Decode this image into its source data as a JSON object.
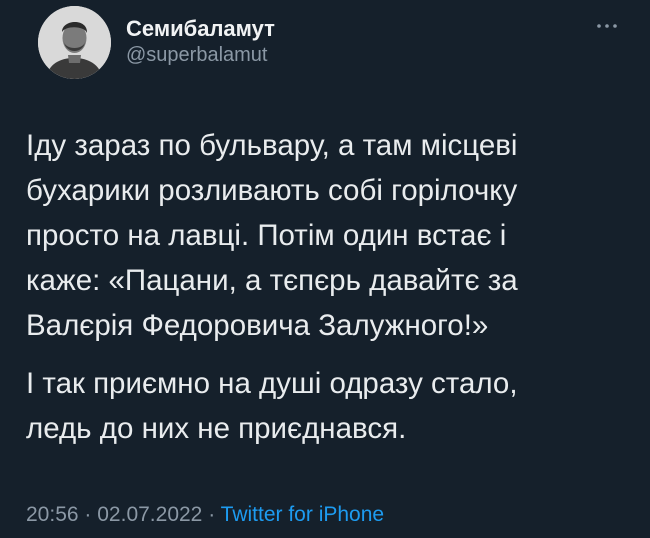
{
  "tweet": {
    "author": {
      "display_name": "Семибаламут",
      "handle": "@superbalamut",
      "avatar_icon": "profile-photo"
    },
    "more_icon": "more-horizontal-icon",
    "text_paragraphs": [
      "Іду зараз по бульвару, а там місцеві\nбухарики розливають собі горілочку\nпросто на лавці. Потім один встає і\nкаже: «Пацани, а тєпєрь давайтє за\nВалєрія Федоровича Залужного!»",
      "І так приємно на душі одразу стало,\nледь до них не приєднався."
    ],
    "time": "20:56",
    "date": "02.07.2022",
    "separator": "·",
    "source": "Twitter for iPhone"
  },
  "colors": {
    "background": "#15202b",
    "text": "#e9ecee",
    "secondary": "#8b98a5",
    "link": "#1d9bf0"
  }
}
